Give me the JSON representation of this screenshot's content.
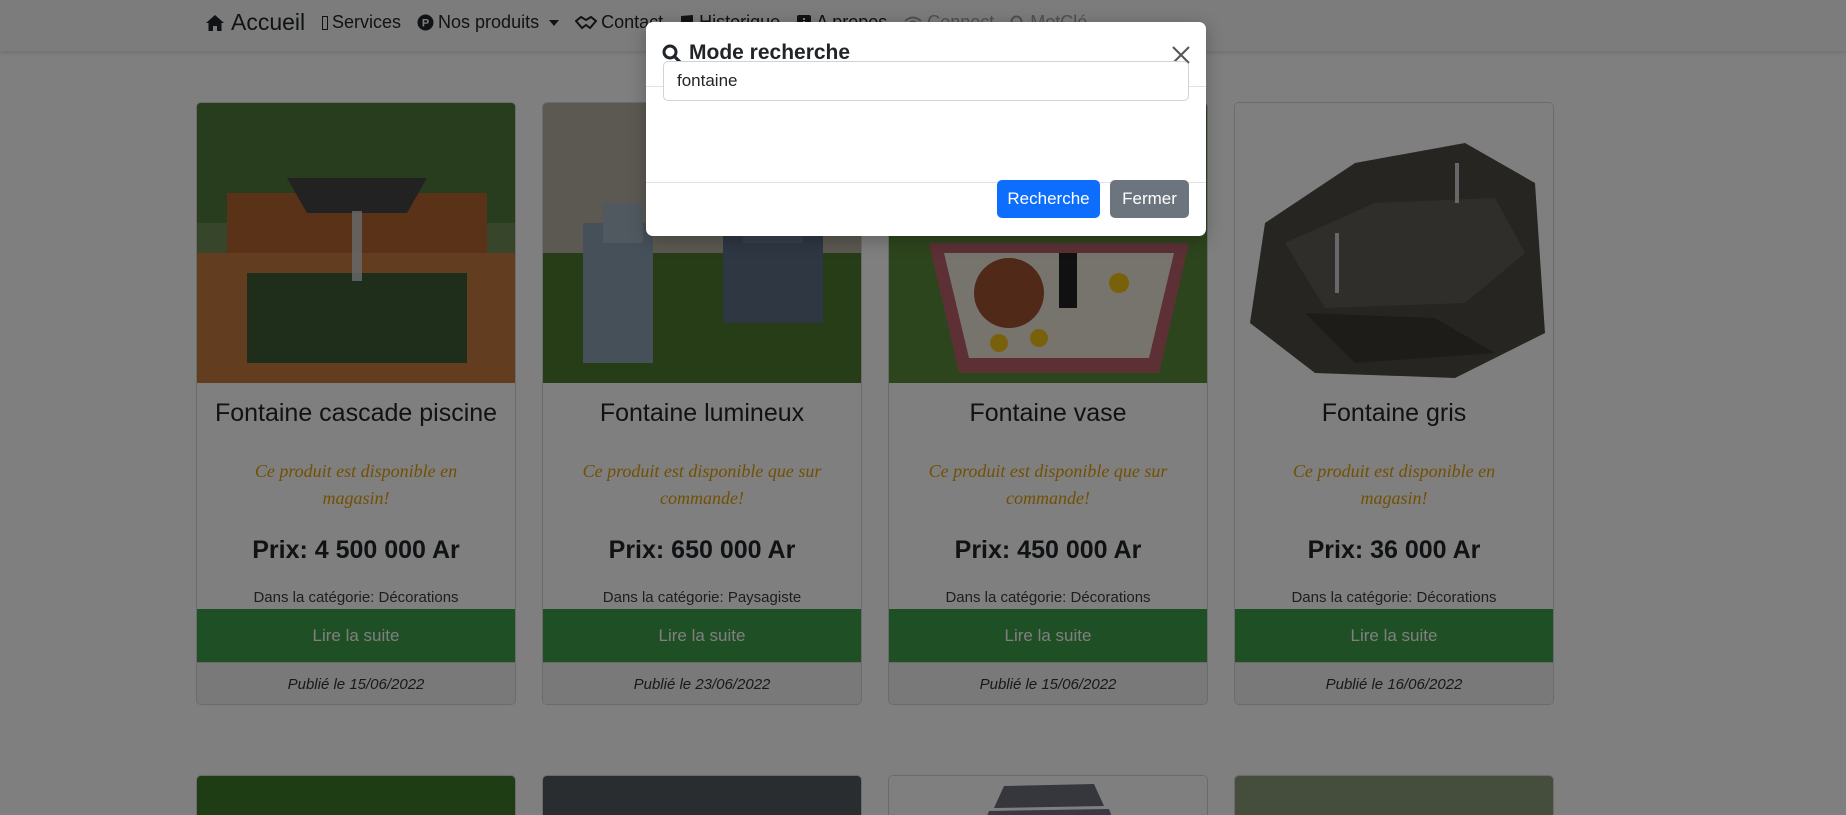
{
  "navbar": {
    "brand": "Accueil",
    "items": [
      {
        "label": "Services",
        "icon": "box-icon"
      },
      {
        "label": "Nos produits",
        "icon": "p-circle-icon",
        "dropdown": true
      },
      {
        "label": "Contact",
        "icon": "handshake-icon"
      },
      {
        "label": "Historique",
        "icon": "book-icon"
      },
      {
        "label": "A propos",
        "icon": "info-icon"
      },
      {
        "label": "Connect",
        "icon": "wifi-icon"
      },
      {
        "label": "MotClé",
        "icon": "search-icon"
      }
    ]
  },
  "products": [
    {
      "title": "Fontaine cascade piscine",
      "availability": "Ce produit est disponible en magasin!",
      "price": "Prix: 4 500 000 Ar",
      "category": "Dans la catégorie: Décorations",
      "button": "Lire la suite",
      "published": "Publié le 15/06/2022"
    },
    {
      "title": "Fontaine lumineux",
      "availability": "Ce produit est disponible que sur commande!",
      "price": "Prix: 650 000 Ar",
      "category": "Dans la catégorie: Paysagiste",
      "button": "Lire la suite",
      "published": "Publié le 23/06/2022"
    },
    {
      "title": "Fontaine vase",
      "availability": "Ce produit est disponible que sur commande!",
      "price": "Prix: 450 000 Ar",
      "category": "Dans la catégorie: Décorations",
      "button": "Lire la suite",
      "published": "Publié le 15/06/2022"
    },
    {
      "title": "Fontaine gris",
      "availability": "Ce produit est disponible en magasin!",
      "price": "Prix: 36 000 Ar",
      "category": "Dans la catégorie: Décorations",
      "button": "Lire la suite",
      "published": "Publié le 16/06/2022"
    }
  ],
  "modal": {
    "title": "Mode recherche",
    "search_value": "fontaine",
    "search_button": "Recherche",
    "close_button": "Fermer"
  },
  "colors": {
    "primary": "#0d6efd",
    "secondary": "#6c757d",
    "card_button": "#3e9e49",
    "availability_text": "#e3a008"
  }
}
